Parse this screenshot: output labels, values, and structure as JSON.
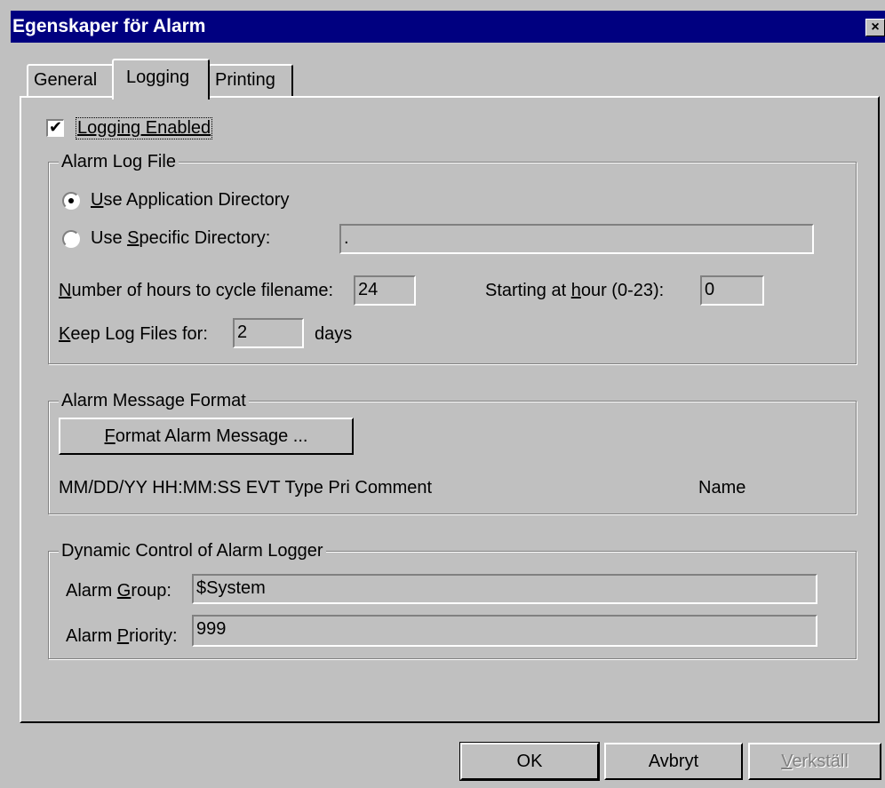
{
  "window": {
    "title": "Egenskaper för Alarm",
    "close_label": "×"
  },
  "tabs": [
    {
      "label": "General",
      "active": false
    },
    {
      "label": "Logging",
      "active": true
    },
    {
      "label": "Printing",
      "active": false
    }
  ],
  "logging_enabled": {
    "label": "Logging Enabled",
    "checked": true,
    "check_glyph": "✔"
  },
  "alarm_log_file": {
    "legend": "Alarm Log File",
    "use_app_dir": {
      "label_u": "U",
      "label_rest": "se Application Directory",
      "selected": true
    },
    "use_specific_dir": {
      "label_pre": "Use ",
      "label_u": "S",
      "label_rest": "pecific Directory:",
      "selected": false,
      "value": "."
    },
    "cycle_hours": {
      "label_u": "N",
      "label_rest": "umber of hours to cycle filename:",
      "value": "24"
    },
    "start_hour": {
      "label_pre": "Starting at ",
      "label_u": "h",
      "label_rest": "our (0-23):",
      "value": "0"
    },
    "keep_files": {
      "label_u": "K",
      "label_rest": "eep Log Files for:",
      "value": "2",
      "unit": "days"
    }
  },
  "alarm_message_format": {
    "legend": "Alarm Message Format",
    "format_button": {
      "label_u": "F",
      "label_rest": "ormat Alarm Message ..."
    },
    "preview": "MM/DD/YY HH:MM:SS EVT Type Pri Comment",
    "preview_name": "Name"
  },
  "dynamic_control": {
    "legend": "Dynamic Control of Alarm Logger",
    "group": {
      "label_pre": "Alarm ",
      "label_u": "G",
      "label_rest": "roup:",
      "value": "$System"
    },
    "priority": {
      "label_pre": "Alarm ",
      "label_u": "P",
      "label_rest": "riority:",
      "value": "999"
    }
  },
  "buttons": {
    "ok": "OK",
    "cancel": "Avbryt",
    "apply_u": "V",
    "apply_rest": "erkställ"
  },
  "colors": {
    "face": "#c0c0c0",
    "titlebar": "#000080",
    "shadow": "#808080",
    "highlight": "#ffffff"
  }
}
